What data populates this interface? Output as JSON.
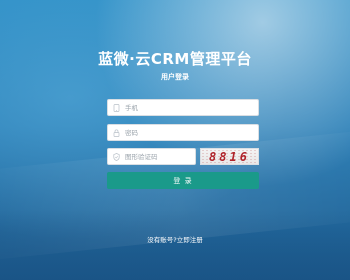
{
  "header": {
    "title": "蓝微·云CRM管理平台",
    "subtitle": "用户登录"
  },
  "form": {
    "phone_placeholder": "手机",
    "password_placeholder": "密码",
    "captcha_placeholder": "图形验证码",
    "captcha_code": "8816",
    "login_label": "登 录",
    "register_link": "没有账号?立即注册"
  },
  "icons": {
    "phone": "phone-icon",
    "password": "lock-icon",
    "captcha": "shield-icon"
  },
  "colors": {
    "accent": "#1a9a8a",
    "background": "#2a7fb7",
    "captcha_text": "#b0232a"
  }
}
